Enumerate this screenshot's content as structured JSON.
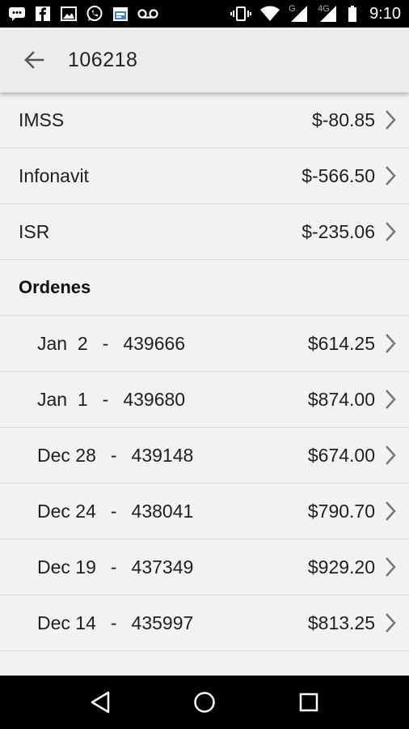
{
  "status_bar": {
    "time": "9:10",
    "network_letter": "G",
    "network_4g": "4G",
    "left_icons": [
      "messages-icon",
      "facebook-icon",
      "gallery-icon",
      "whatsapp-icon",
      "calendar-icon",
      "voicemail-icon"
    ],
    "right_icons": [
      "vibrate-icon",
      "wifi-icon",
      "signal-icon",
      "signal-4g-icon",
      "battery-icon"
    ]
  },
  "app_bar": {
    "title": "106218"
  },
  "deductions": [
    {
      "label": "IMSS",
      "amount": "$-80.85"
    },
    {
      "label": "Infonavit",
      "amount": "$-566.50"
    },
    {
      "label": "ISR",
      "amount": "$-235.06"
    }
  ],
  "orders_section": {
    "title": "Ordenes",
    "items": [
      {
        "date": "Jan  2",
        "separator": "-",
        "number": "439666",
        "amount": "$614.25"
      },
      {
        "date": "Jan  1",
        "separator": "-",
        "number": "439680",
        "amount": "$874.00"
      },
      {
        "date": "Dec 28",
        "separator": "-",
        "number": "439148",
        "amount": "$674.00"
      },
      {
        "date": "Dec 24",
        "separator": "-",
        "number": "438041",
        "amount": "$790.70"
      },
      {
        "date": "Dec 19",
        "separator": "-",
        "number": "437349",
        "amount": "$929.20"
      },
      {
        "date": "Dec 14",
        "separator": "-",
        "number": "435997",
        "amount": "$813.25"
      }
    ]
  },
  "nav_bar": {
    "buttons": [
      "back-triangle-icon",
      "home-circle-icon",
      "recents-square-icon"
    ]
  }
}
